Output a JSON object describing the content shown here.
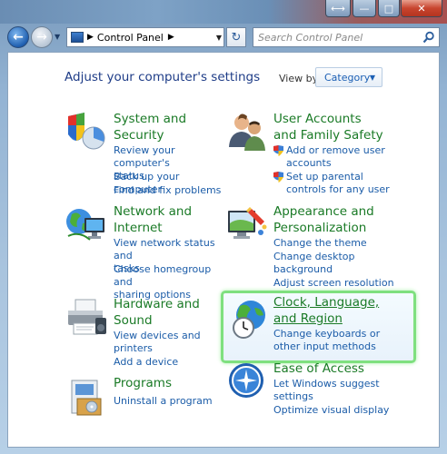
{
  "window": {
    "minimize_glyph": "⟷",
    "maximize_glyph": "—",
    "restore_glyph": "□",
    "close_glyph": "✕"
  },
  "nav": {
    "back_glyph": "←",
    "forward_glyph": "→",
    "history_glyph": "▼",
    "address_segment": "Control Panel",
    "address_separator": "▶",
    "address_dropdown_glyph": "▼",
    "refresh_glyph": "↻",
    "search_placeholder": "Search Control Panel"
  },
  "header": {
    "title": "Adjust your computer's settings",
    "view_by_label": "View by:",
    "view_by_value": "Category",
    "view_by_arrow": "▼"
  },
  "categories": {
    "system": {
      "title_1": "System and",
      "title_2": "Security",
      "links": [
        "Review your computer's",
        "status",
        "Back up your computer",
        "Find and fix problems"
      ]
    },
    "users": {
      "title_1": "User Accounts",
      "title_2": "and Family Safety",
      "links": [
        "Add or remove user",
        "accounts",
        "Set up parental",
        "controls for any user"
      ]
    },
    "network": {
      "title_1": "Network and",
      "title_2": "Internet",
      "links": [
        "View network status and",
        "tasks",
        "Choose homegroup and",
        "sharing options"
      ]
    },
    "appearance": {
      "title_1": "Appearance and",
      "title_2": "Personalization",
      "links": [
        "Change the theme",
        "Change desktop",
        "background",
        "Adjust screen resolution"
      ]
    },
    "hardware": {
      "title_1": "Hardware and",
      "title_2": "Sound",
      "links": [
        "View devices and",
        "printers",
        "Add a device"
      ]
    },
    "clock": {
      "title_1": "Clock, Language,",
      "title_2": "and Region",
      "links": [
        "Change keyboards or",
        "other input methods"
      ]
    },
    "programs": {
      "title_1": "Programs",
      "links": [
        "Uninstall a program"
      ]
    },
    "ease": {
      "title_1": "Ease of Access",
      "links": [
        "Let Windows suggest",
        "settings",
        "Optimize visual display"
      ]
    }
  },
  "colors": {
    "accent": "#1e3c87",
    "category_title": "#1a7a26",
    "link": "#1b5ca8",
    "highlight": "#7fe07f"
  }
}
